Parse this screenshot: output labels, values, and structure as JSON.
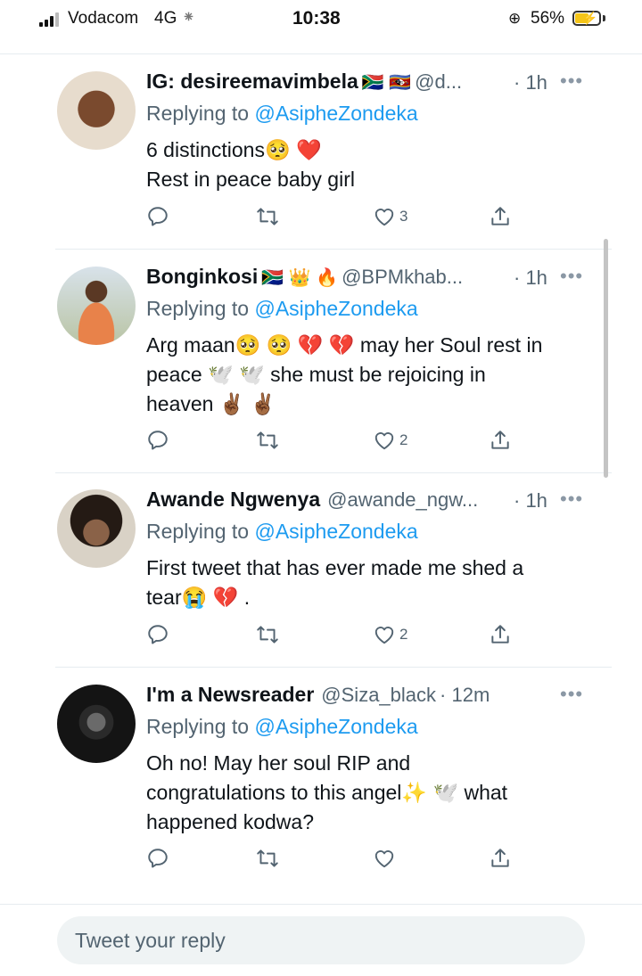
{
  "status_bar": {
    "carrier": "Vodacom",
    "network": "4G",
    "time": "10:38",
    "battery": "56%",
    "battery_level": 0.56
  },
  "tweets": [
    {
      "display_name": "IG: desireemavimbela",
      "name_emoji": "🇿🇦 🇸🇿",
      "handle": "@d...",
      "time": "· 1h",
      "replying_prefix": "Replying to ",
      "replying_to": "@AsipheZondeka",
      "lines": [
        "6 distinctions🥺 ❤️",
        "Rest in peace baby girl"
      ],
      "likes": "3"
    },
    {
      "display_name": "Bonginkosi",
      "name_emoji": "🇿🇦 👑 🔥",
      "handle": "@BPMkhab...",
      "time": "· 1h",
      "replying_prefix": "Replying to ",
      "replying_to": "@AsipheZondeka",
      "lines": [
        "Arg maan🥺 🥺  💔 💔 may her Soul rest in",
        "peace 🕊️ 🕊️ she must be rejoicing in",
        "heaven ✌🏾 ✌🏾"
      ],
      "likes": "2"
    },
    {
      "display_name": "Awande Ngwenya",
      "name_emoji": "",
      "handle": "@awande_ngw...",
      "time": "· 1h",
      "replying_prefix": "Replying to ",
      "replying_to": "@AsipheZondeka",
      "lines": [
        "First tweet that has ever made me shed a",
        "tear😭 💔 ."
      ],
      "likes": "2"
    },
    {
      "display_name": "I'm a Newsreader",
      "name_emoji": "",
      "handle": "@Siza_black",
      "time": "· 12m",
      "replying_prefix": "Replying to ",
      "replying_to": "@AsipheZondeka",
      "lines": [
        "Oh no! May her soul RIP and",
        "congratulations to this angel✨ 🕊️ what",
        "happened kodwa?"
      ],
      "likes": ""
    }
  ],
  "icons": {
    "reply": "reply-icon",
    "retweet": "retweet-icon",
    "like": "heart-icon",
    "share": "share-icon",
    "more": "more-icon"
  },
  "colors": {
    "link": "#1d9bf0",
    "secondary_text": "#536471",
    "text": "#0f1419"
  },
  "reply_box": {
    "placeholder": "Tweet your reply"
  }
}
